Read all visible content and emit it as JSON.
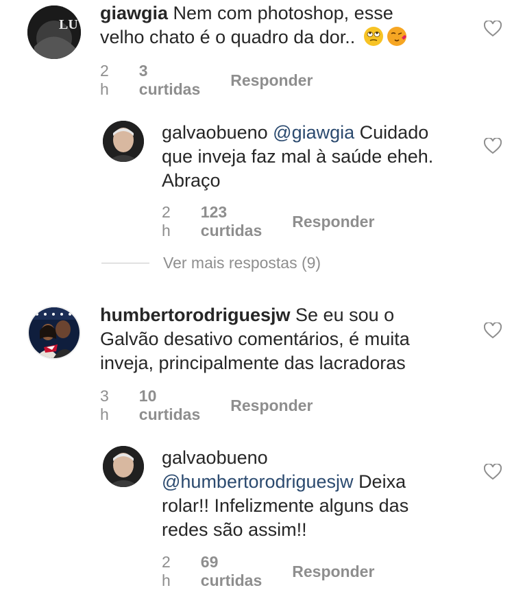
{
  "comments": [
    {
      "user": "giawgia",
      "text": "Nem com photoshop,  esse",
      "text2": "velho chato é o quadro da dor..",
      "time": "2 h",
      "likes": "3 curtidas",
      "reply": "Responder",
      "avatar_label": "LU"
    },
    {
      "user": "galvaobueno",
      "mention": "@giawgia",
      "text": "Cuidado",
      "text2": "que inveja faz mal à saúde eheh.",
      "text3": "Abraço",
      "time": "2 h",
      "likes": "123 curtidas",
      "reply": "Responder"
    },
    {
      "user": "humbertorodriguesjw",
      "text": "Se eu sou o",
      "text2": "Galvão desativo comentários, é muita",
      "text3": "inveja, principalmente das lacradoras",
      "time": "3 h",
      "likes": "10 curtidas",
      "reply": "Responder"
    },
    {
      "user": "galvaobueno",
      "mention": "@humbertorodriguesjw",
      "text": "Deixa",
      "text2": "rolar!! Infelizmente alguns das",
      "text3": "redes são assim!!",
      "time": "2 h",
      "likes": "69 curtidas",
      "reply": "Responder"
    }
  ],
  "more_replies": "Ver mais respostas (9)",
  "colors": {
    "text": "#262626",
    "meta": "#8e8e8e",
    "mention": "#2b4a6f"
  },
  "icons": [
    "heart-icon",
    "face-rolling-eyes-emoji",
    "face-blowing-kiss-emoji"
  ]
}
